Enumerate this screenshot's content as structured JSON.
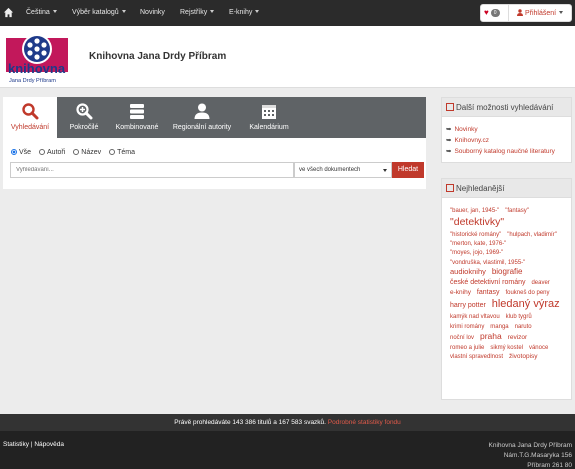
{
  "topnav": {
    "items": [
      {
        "label": "Čeština",
        "dropdown": true
      },
      {
        "label": "Výběr katalogů",
        "dropdown": true
      },
      {
        "label": "Novinky",
        "dropdown": false
      },
      {
        "label": "Rejstříky",
        "dropdown": true
      },
      {
        "label": "E-knihy",
        "dropdown": true
      }
    ],
    "favorites_count": "0",
    "login_label": "Přihlášení"
  },
  "header": {
    "logo_text": "knihovna",
    "logo_subtext": "Jana Drdy Příbram",
    "library_name": "Knihovna Jana Drdy Příbram"
  },
  "search": {
    "tabs": [
      {
        "label": "Vyhledávání",
        "icon": "search-icon",
        "active": true
      },
      {
        "label": "Pokročilé",
        "icon": "zoom-plus-icon",
        "active": false
      },
      {
        "label": "Kombinované",
        "icon": "database-icon",
        "active": false
      },
      {
        "label": "Regionální autority",
        "icon": "user-icon",
        "active": false
      },
      {
        "label": "Kalendárium",
        "icon": "calendar-icon",
        "active": false
      }
    ],
    "radios": [
      {
        "label": "Vše",
        "checked": true
      },
      {
        "label": "Autoři",
        "checked": false
      },
      {
        "label": "Název",
        "checked": false
      },
      {
        "label": "Téma",
        "checked": false
      }
    ],
    "placeholder": "Vyhledávání...",
    "scope": "ve všech dokumentech",
    "button": "Hledat"
  },
  "sidebar": {
    "more_title": "Další možnosti vyhledávání",
    "more_links": [
      "Novinky",
      "Knihovny.cz",
      "Souborný katalog naučné literatury"
    ],
    "popular_title": "Nejhledanější",
    "popular_tags": [
      {
        "text": "\"bauer, jan, 1945-\"",
        "size": 6
      },
      {
        "text": "\"fantasy\"",
        "size": 6
      },
      {
        "text": "\"detektivky\"",
        "size": 10.5
      },
      {
        "text": "\"historické romány\"",
        "size": 6
      },
      {
        "text": "\"hulpach, vladimír\"",
        "size": 6
      },
      {
        "text": "\"merton, kate, 1976-\"",
        "size": 6
      },
      {
        "text": "\"moyes, jojo, 1969-\"",
        "size": 6
      },
      {
        "text": "\"vondruška, vlastimil, 1955-\"",
        "size": 6
      },
      {
        "text": "audioknihy",
        "size": 7.5
      },
      {
        "text": "biografie",
        "size": 8
      },
      {
        "text": "české detektivní romány",
        "size": 7
      },
      {
        "text": "deaver",
        "size": 6
      },
      {
        "text": "e-knihy",
        "size": 6.5
      },
      {
        "text": "fantasy",
        "size": 7
      },
      {
        "text": "foukneš do peny",
        "size": 6
      },
      {
        "text": "harry potter",
        "size": 7
      },
      {
        "text": "hledaný výraz",
        "size": 11
      },
      {
        "text": "kamýk nad vltavou",
        "size": 6
      },
      {
        "text": "klub tygrů",
        "size": 6
      },
      {
        "text": "krimi romány",
        "size": 6
      },
      {
        "text": "manga",
        "size": 6
      },
      {
        "text": "naruto",
        "size": 6
      },
      {
        "text": "noční lov",
        "size": 6
      },
      {
        "text": "praha",
        "size": 8.5
      },
      {
        "text": "revizor",
        "size": 6.5
      },
      {
        "text": "romeo a julie",
        "size": 6
      },
      {
        "text": "sikmý kostel",
        "size": 6
      },
      {
        "text": "vánoce",
        "size": 6
      },
      {
        "text": "vlastní spravedlnost",
        "size": 6
      },
      {
        "text": "životopisy",
        "size": 6.5
      }
    ]
  },
  "status": {
    "text": "Právě prohledáváte 143 386 titulů a 167 583 svazků.",
    "link": "Podrobné statistiky fondu"
  },
  "footer": {
    "links": [
      "Statistiky",
      "Nápověda"
    ],
    "separator": "|",
    "address": [
      "Knihovna Jana Drdy Příbram",
      "Nám.T.G.Masaryka 156",
      "Příbram 261 80"
    ]
  },
  "colors": {
    "accent": "#c0392b",
    "tabbar": "#5f6366",
    "navbar": "#2b2b2b"
  }
}
